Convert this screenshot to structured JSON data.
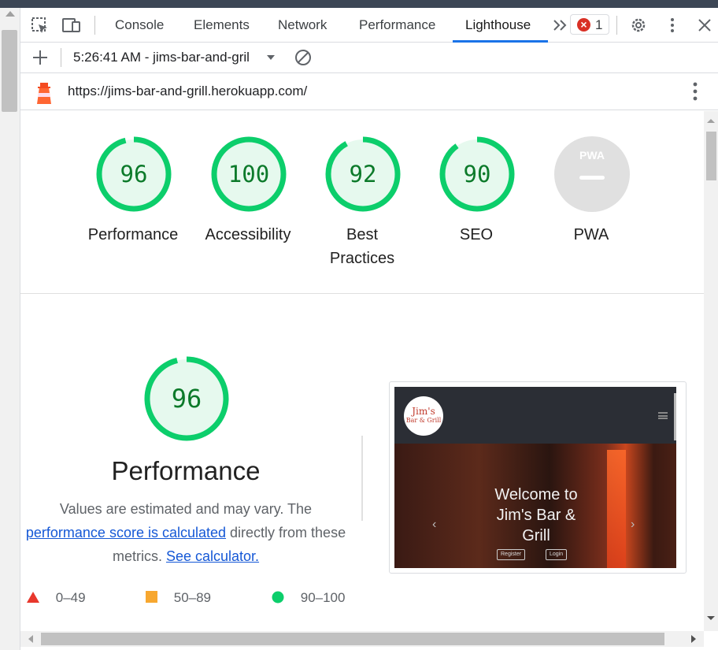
{
  "devtools": {
    "tabs": [
      {
        "label": "Console"
      },
      {
        "label": "Elements"
      },
      {
        "label": "Network"
      },
      {
        "label": "Performance"
      },
      {
        "label": "Lighthouse"
      }
    ],
    "active_tab": "Lighthouse",
    "error_count": "1",
    "icons": [
      "inspect-element-icon",
      "device-toolbar-icon",
      "more-tabs-icon",
      "error-icon",
      "settings-gear-icon",
      "kebab-menu-icon",
      "close-icon"
    ]
  },
  "report_toolbar": {
    "report_selector": "5:26:41 AM - jims-bar-and-gril",
    "icons": [
      "add-icon",
      "dropdown-caret-icon",
      "clear-icon"
    ]
  },
  "url_bar": {
    "url": "https://jims-bar-and-grill.herokuapp.com/",
    "icons": [
      "lighthouse-logo-icon",
      "kebab-menu-icon"
    ]
  },
  "scores": [
    {
      "label": "Performance",
      "value": "96",
      "score": 96
    },
    {
      "label": "Accessibility",
      "value": "100",
      "score": 100
    },
    {
      "label": "Best Practices",
      "value": "92",
      "score": 92
    },
    {
      "label": "SEO",
      "value": "90",
      "score": 90
    },
    {
      "label": "PWA",
      "value": "",
      "badge": "PWA"
    }
  ],
  "performance_section": {
    "score": "96",
    "title": "Performance",
    "desc_prefix": "Values are estimated and may vary. The",
    "link_text": "performance score is calculated",
    "desc_middle": "directly from these metrics.",
    "calculator_link": "See calculator.",
    "legend": [
      {
        "range": "0–49",
        "color": "#e8372c",
        "shape": "triangle"
      },
      {
        "range": "50–89",
        "color": "#f7a72f",
        "shape": "square"
      },
      {
        "range": "90–100",
        "color": "#0cce6b",
        "shape": "circle"
      }
    ]
  },
  "screenshot": {
    "logo_text_line1": "Jim's",
    "logo_text_line2": "Bar & Grill",
    "welcome": "Welcome to Jim's Bar & Grill",
    "register": "Register",
    "login": "Login"
  },
  "colors": {
    "pass_green": "#0cce6b",
    "pass_text": "#0c7a2a",
    "link_blue": "#1558d6",
    "tab_underline": "#1a73e8"
  }
}
